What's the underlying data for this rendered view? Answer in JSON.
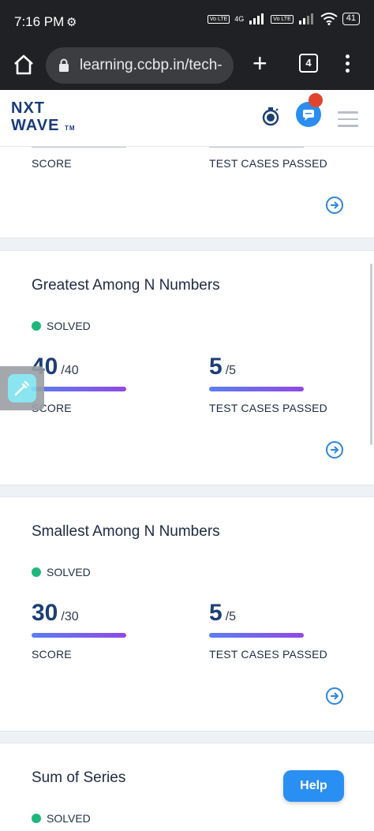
{
  "status_bar": {
    "time": "7:16 PM",
    "network_tag": "4G",
    "sim1": "Vo LTE",
    "sim2": "Vo LTE",
    "battery": "41"
  },
  "browser": {
    "url": "learning.ccbp.in/tech-",
    "tab_count": "4"
  },
  "app": {
    "logo_line1": "NXT",
    "logo_line2": "WAVE",
    "logo_tm": "TM"
  },
  "partial_card": {
    "score_label": "SCORE",
    "tests_label": "TEST CASES PASSED"
  },
  "cards": [
    {
      "title": "Greatest Among N Numbers",
      "status": "SOLVED",
      "score": "40",
      "score_max": "/40",
      "tests": "5",
      "tests_max": "/5",
      "score_label": "SCORE",
      "tests_label": "TEST CASES PASSED"
    },
    {
      "title": "Smallest Among N Numbers",
      "status": "SOLVED",
      "score": "30",
      "score_max": "/30",
      "tests": "5",
      "tests_max": "/5",
      "score_label": "SCORE",
      "tests_label": "TEST CASES PASSED"
    },
    {
      "title": "Sum of Series",
      "status": "SOLVED"
    }
  ],
  "help_label": "Help",
  "colors": {
    "accent": "#2b86e0",
    "solved": "#1fb87c",
    "progress_start": "#5b7ef0",
    "progress_end": "#8f4ae6",
    "title": "#1e2a44"
  }
}
